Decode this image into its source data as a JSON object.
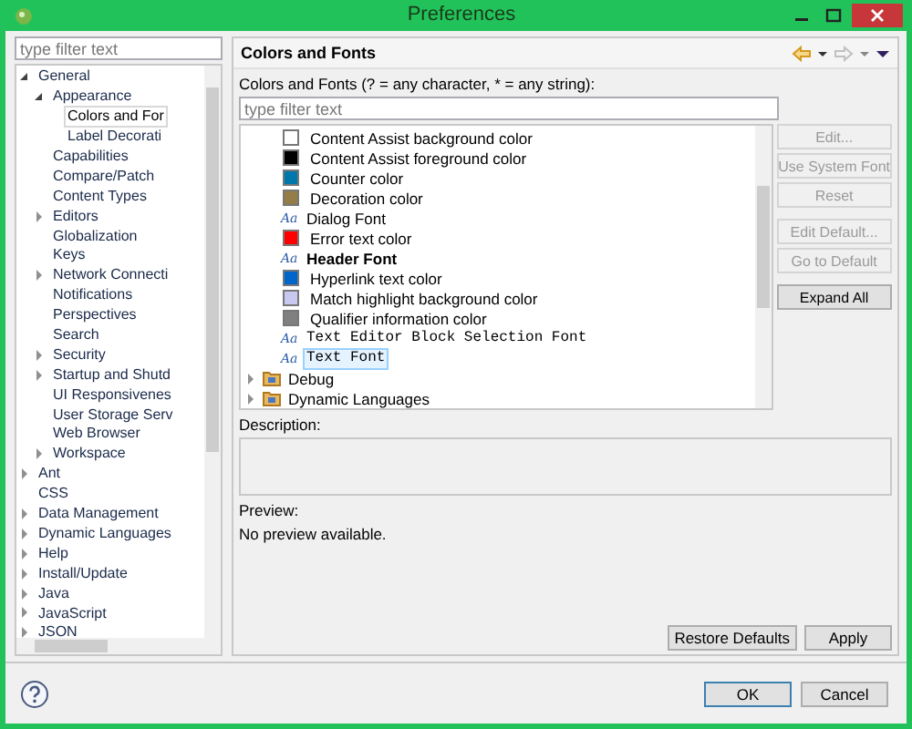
{
  "window": {
    "title": "Preferences"
  },
  "sidebar": {
    "filter_placeholder": "type filter text",
    "tree": [
      {
        "label": "General",
        "expanded": true,
        "selected": false,
        "children": [
          {
            "label": "Appearance",
            "expanded": true,
            "selected": false,
            "children": [
              {
                "label": "Colors and For",
                "selected": true
              },
              {
                "label": "Label Decorati",
                "selected": false
              }
            ]
          },
          {
            "label": "Capabilities",
            "selected": false
          },
          {
            "label": "Compare/Patch",
            "selected": false
          },
          {
            "label": "Content Types",
            "selected": false
          },
          {
            "label": "Editors",
            "expanded": false,
            "selected": false
          },
          {
            "label": "Globalization",
            "selected": false
          },
          {
            "label": "Keys",
            "selected": false
          },
          {
            "label": "Network Connecti",
            "expanded": false,
            "selected": false
          },
          {
            "label": "Notifications",
            "selected": false
          },
          {
            "label": "Perspectives",
            "selected": false
          },
          {
            "label": "Search",
            "selected": false
          },
          {
            "label": "Security",
            "expanded": false,
            "selected": false
          },
          {
            "label": "Startup and Shutd",
            "expanded": false,
            "selected": false
          },
          {
            "label": "UI Responsivenes",
            "selected": false
          },
          {
            "label": "User Storage Serv",
            "selected": false
          },
          {
            "label": "Web Browser",
            "selected": false
          },
          {
            "label": "Workspace",
            "expanded": false,
            "selected": false
          }
        ]
      },
      {
        "label": "Ant",
        "expanded": false,
        "selected": false
      },
      {
        "label": "CSS",
        "selected": false
      },
      {
        "label": "Data Management",
        "expanded": false,
        "selected": false
      },
      {
        "label": "Dynamic Languages",
        "expanded": false,
        "selected": false
      },
      {
        "label": "Help",
        "expanded": false,
        "selected": false
      },
      {
        "label": "Install/Update",
        "expanded": false,
        "selected": false
      },
      {
        "label": "Java",
        "expanded": false,
        "selected": false
      },
      {
        "label": "JavaScript",
        "expanded": false,
        "selected": false
      },
      {
        "label": "JSON",
        "expanded": false,
        "selected": false
      }
    ]
  },
  "page": {
    "title": "Colors and Fonts",
    "filter_label": "Colors and Fonts (? = any character, * = any string):",
    "filter_placeholder": "type filter text",
    "items": [
      {
        "kind": "color",
        "label": "Content Assist background color",
        "color": "#ffffff",
        "selected": false
      },
      {
        "kind": "color",
        "label": "Content Assist foreground color",
        "color": "#000000",
        "selected": false
      },
      {
        "kind": "color",
        "label": "Counter color",
        "color": "#0077aa",
        "selected": false
      },
      {
        "kind": "color",
        "label": "Decoration color",
        "color": "#957d47",
        "selected": false
      },
      {
        "kind": "font",
        "icon": "Aa",
        "label": "Dialog Font",
        "selected": false
      },
      {
        "kind": "color",
        "label": "Error text color",
        "color": "#ff0000",
        "selected": false
      },
      {
        "kind": "boldfont",
        "icon": "Aa",
        "label": "Header Font",
        "selected": false
      },
      {
        "kind": "color",
        "label": "Hyperlink text color",
        "color": "#0066cc",
        "selected": false
      },
      {
        "kind": "color",
        "label": "Match highlight background color",
        "color": "#c8c8f0",
        "selected": false
      },
      {
        "kind": "color",
        "label": "Qualifier information color",
        "color": "#808080",
        "selected": false
      },
      {
        "kind": "monofont",
        "icon": "Aa",
        "label": "Text Editor Block Selection Font",
        "selected": false
      },
      {
        "kind": "monofont",
        "icon": "Aa",
        "label": "Text Font",
        "selected": true
      },
      {
        "kind": "category",
        "label": "Debug",
        "expanded": false,
        "selected": false
      },
      {
        "kind": "category",
        "label": "Dynamic Languages",
        "expanded": false,
        "selected": false
      }
    ],
    "button_groups": [
      [
        {
          "label": "Edit...",
          "disabled": true
        },
        {
          "label": "Use System Font",
          "disabled": true
        },
        {
          "label": "Reset",
          "disabled": true
        }
      ],
      [
        {
          "label": "Edit Default...",
          "disabled": true
        },
        {
          "label": "Go to Default",
          "disabled": true
        }
      ],
      [
        {
          "label": "Expand All",
          "disabled": false
        }
      ]
    ],
    "description_label": "Description:",
    "preview_label": "Preview:",
    "preview_text": "No preview available.",
    "restore_button": "Restore Defaults",
    "apply_button": "Apply"
  },
  "dialog_buttons": [
    {
      "label": "OK",
      "default": true
    },
    {
      "label": "Cancel",
      "default": false
    }
  ]
}
